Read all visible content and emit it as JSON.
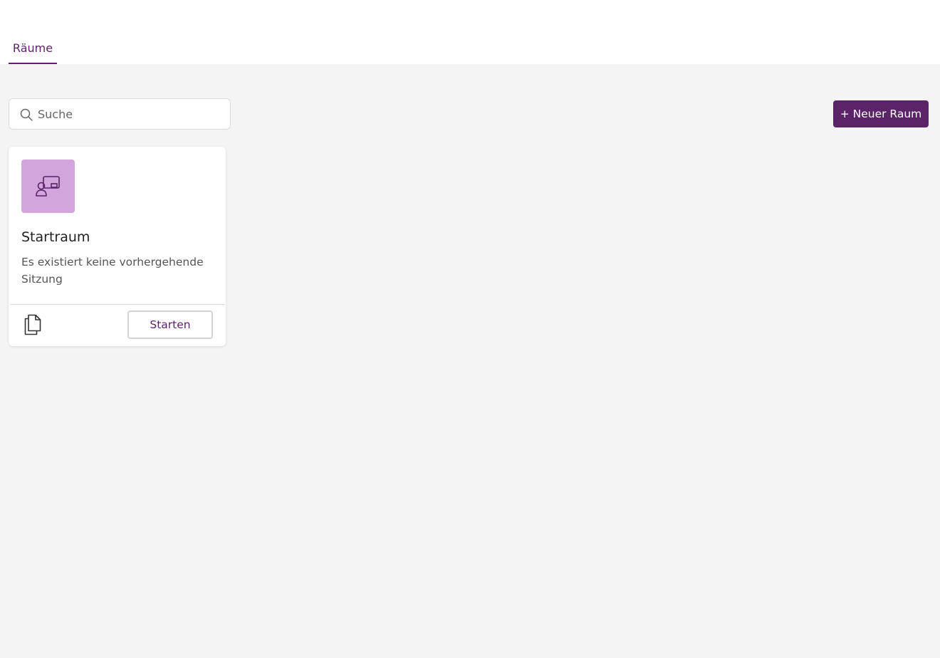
{
  "tabs": [
    {
      "label": "Räume",
      "active": true
    }
  ],
  "search": {
    "placeholder": "Suche",
    "value": "",
    "icon": "search-icon"
  },
  "toolbar": {
    "new_room_label": "+ Neuer Raum"
  },
  "rooms": [
    {
      "name": "Startraum",
      "status": "Es existiert keine vorhergehende Sitzung",
      "icon": "room-presenter-icon",
      "start_label": "Starten",
      "copy_icon": "copy-icon"
    }
  ],
  "colors": {
    "accent": "#5b2468",
    "room_icon_bg": "#d2a6dc",
    "page_bg": "#f4f4f5",
    "header_bg": "#ffffff"
  }
}
